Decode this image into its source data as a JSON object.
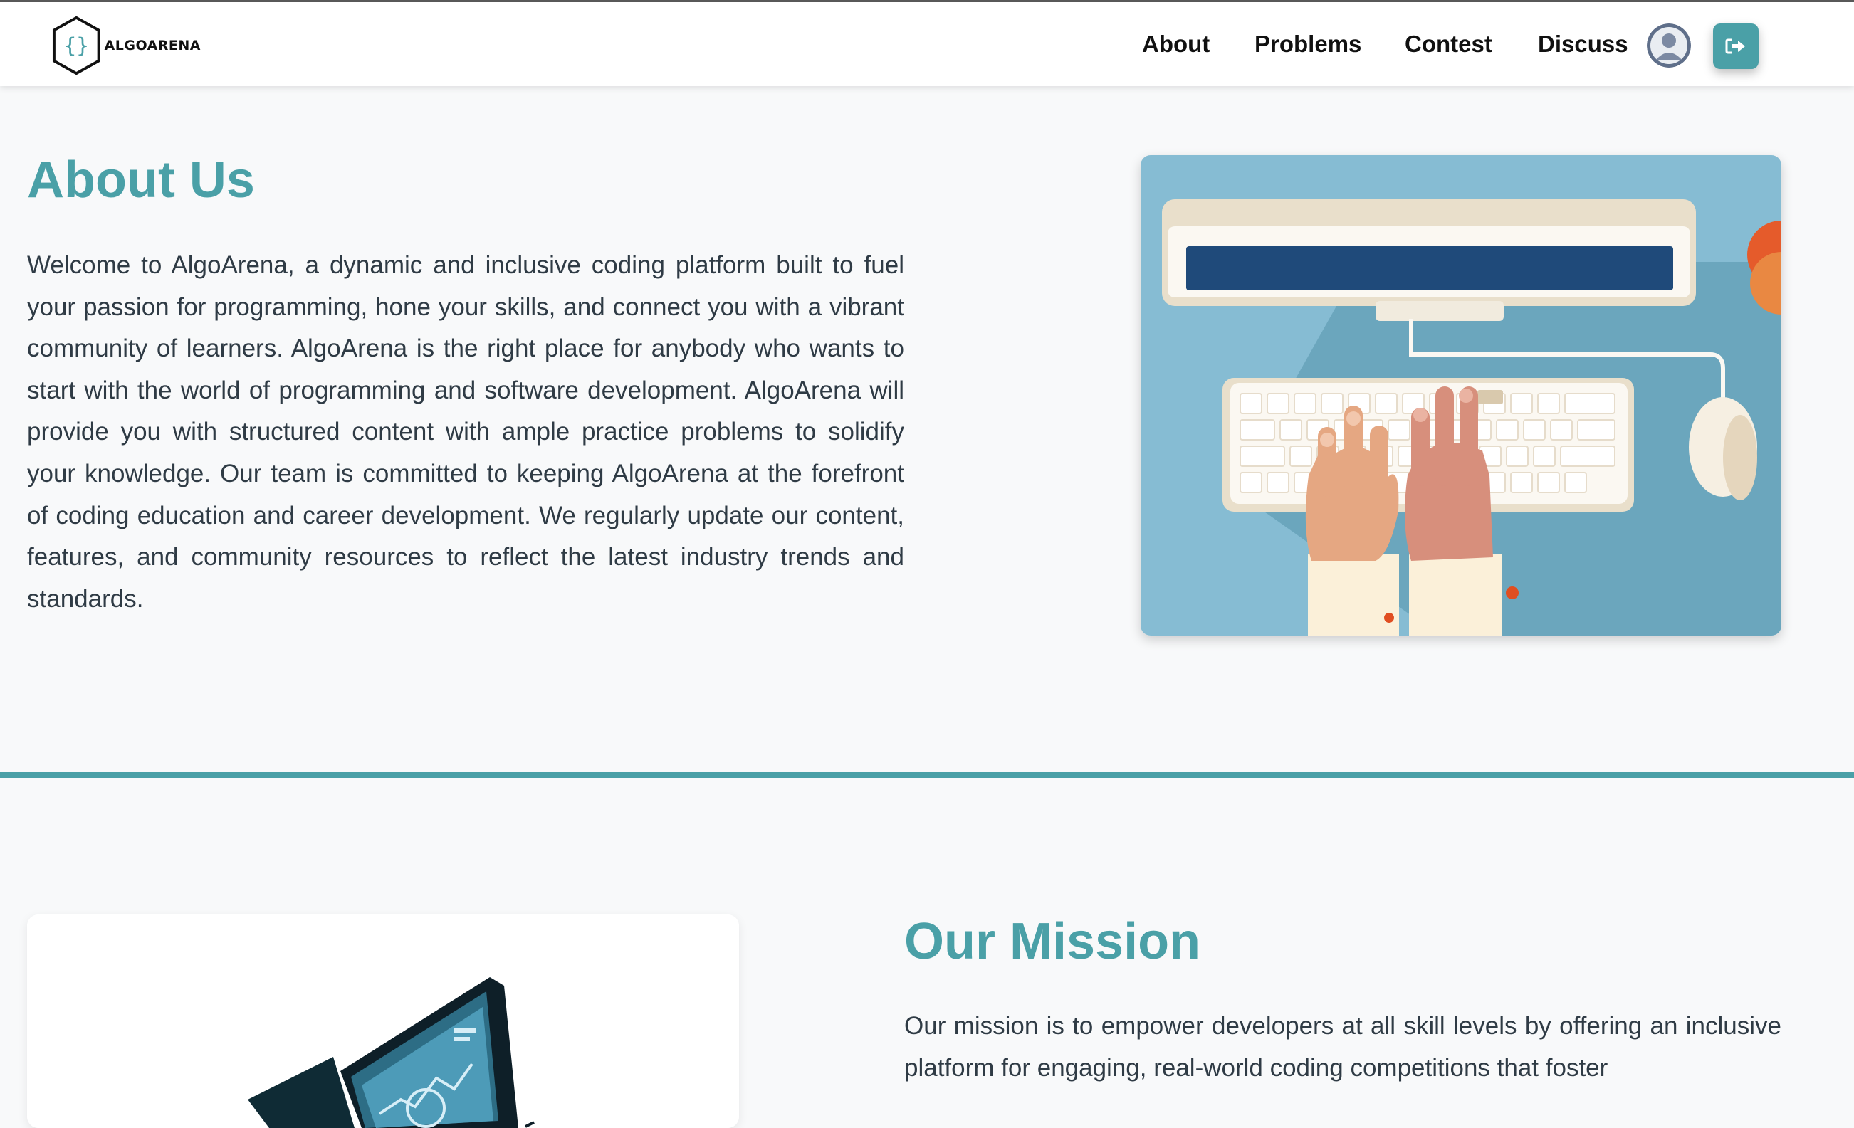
{
  "brand": {
    "logo_text": "ALGOARENA",
    "accent_color": "#4aa0a7"
  },
  "nav": {
    "links": [
      "About",
      "Problems",
      "Contest",
      "Discuss"
    ],
    "avatar_icon": "user-avatar-icon",
    "logout_icon": "sign-out-icon"
  },
  "about": {
    "title": "About Us",
    "body": "Welcome to AlgoArena, a dynamic and inclusive coding platform built to fuel your passion for programming, hone your skills, and connect you with a vibrant community of learners. AlgoArena is the right place for anybody who wants to start with the world of programming and software development. AlgoArena will provide you with structured content with ample practice problems to solidify your knowledge. Our team is committed to keeping AlgoArena at the forefront of coding education and career development. We regularly update our content, features, and community resources to reflect the latest industry trends and standards.",
    "image": "illustration-hands-typing-on-keyboard"
  },
  "mission": {
    "title": "Our Mission",
    "body": "Our mission is to empower developers at all skill levels by offering an inclusive platform for engaging, real-world coding competitions that foster",
    "image": "illustration-computer-monitors"
  }
}
